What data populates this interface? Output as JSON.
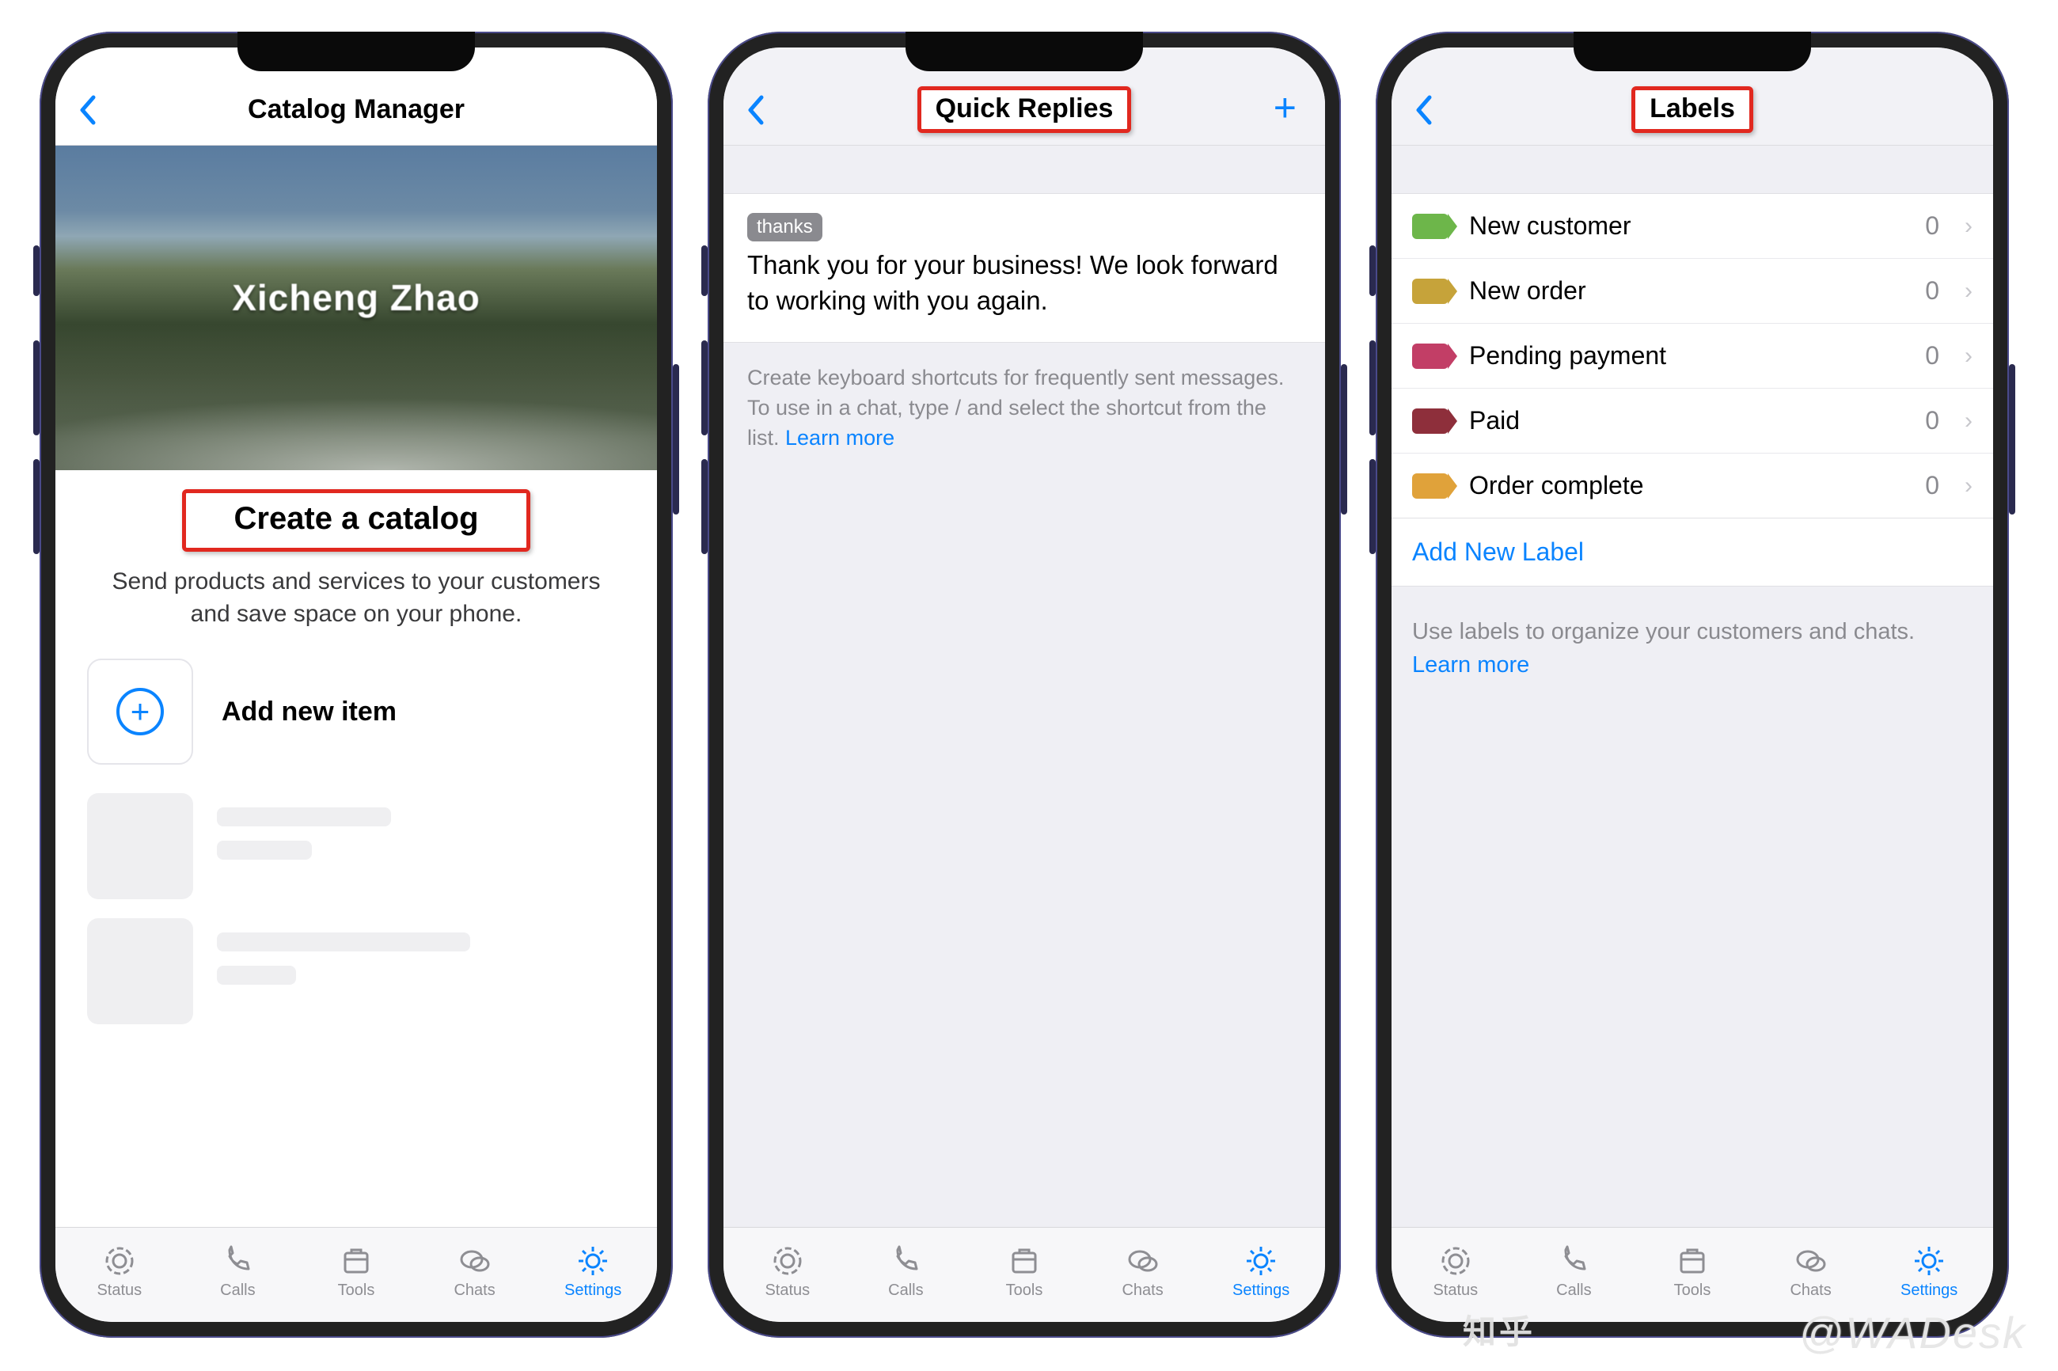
{
  "watermark_text": "@WADesk",
  "zhihu_text": "知乎",
  "tabbar": {
    "items": [
      {
        "label": "Status"
      },
      {
        "label": "Calls"
      },
      {
        "label": "Tools"
      },
      {
        "label": "Chats"
      },
      {
        "label": "Settings"
      }
    ],
    "active_index": 4
  },
  "phone1": {
    "header_title": "Catalog Manager",
    "hero_name": "Xicheng Zhao",
    "create_label": "Create a catalog",
    "subtext": "Send products and services to your customers and save space on your phone.",
    "add_item_label": "Add new item"
  },
  "phone2": {
    "header_title": "Quick Replies",
    "reply_tag": "thanks",
    "reply_text": "Thank you for your business! We look forward to working with you again.",
    "help_text": "Create keyboard shortcuts for frequently sent messages. To use in a chat, type / and select the shortcut from the list. ",
    "learn_more": "Learn more"
  },
  "phone3": {
    "header_title": "Labels",
    "labels": [
      {
        "name": "New customer",
        "count": "0",
        "color": "lt-green"
      },
      {
        "name": "New order",
        "count": "0",
        "color": "lt-yellow"
      },
      {
        "name": "Pending payment",
        "count": "0",
        "color": "lt-pink"
      },
      {
        "name": "Paid",
        "count": "0",
        "color": "lt-red"
      },
      {
        "name": "Order complete",
        "count": "0",
        "color": "lt-orange"
      }
    ],
    "add_label": "Add New Label",
    "help_text": "Use labels to organize your customers and chats.",
    "learn_more": "Learn more"
  }
}
